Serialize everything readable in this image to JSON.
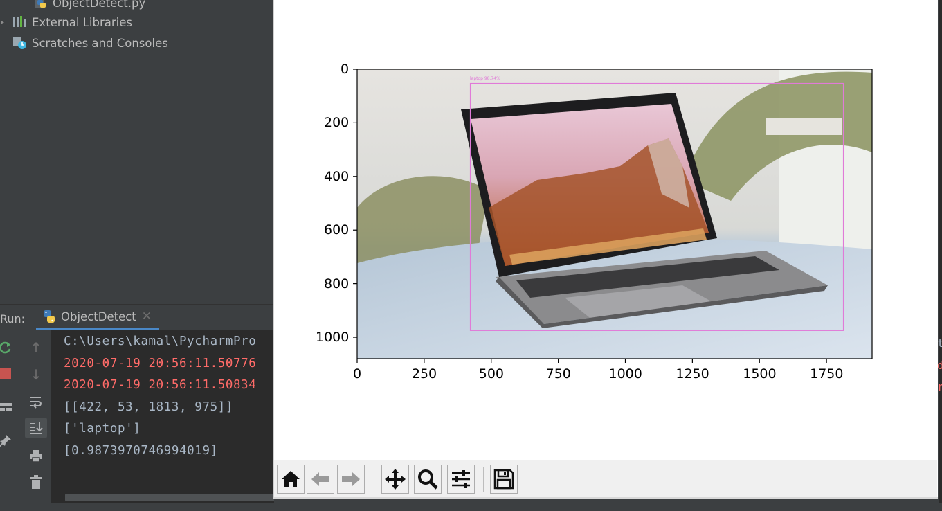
{
  "project_tree": {
    "items": [
      {
        "label": "ObjectDetect.py",
        "icon": "python-file-icon"
      },
      {
        "label": "External Libraries",
        "icon": "library-icon"
      },
      {
        "label": "Scratches and Consoles",
        "icon": "scratches-icon"
      }
    ]
  },
  "run_panel": {
    "label": "Run:",
    "tab_label": "ObjectDetect",
    "console_lines": [
      {
        "text": "C:\\Users\\kamal\\PycharmPro",
        "type": "normal"
      },
      {
        "text": "2020-07-19 20:56:11.50776",
        "type": "error"
      },
      {
        "text": "2020-07-19 20:56:11.50834",
        "type": "error"
      },
      {
        "text": "[[422, 53, 1813, 975]]",
        "type": "normal"
      },
      {
        "text": "['laptop']",
        "type": "normal"
      },
      {
        "text": "[0.9873970746994019]",
        "type": "normal"
      }
    ]
  },
  "right_strip_chars": [
    "t",
    "d",
    "r"
  ],
  "matplotlib": {
    "toolbar": [
      "home-icon",
      "back-icon",
      "forward-icon",
      "pan-icon",
      "zoom-icon",
      "configure-subplots-icon",
      "save-icon"
    ],
    "image": {
      "detection_label": "laptop 98.74%",
      "box_color": "#e07ad8"
    }
  },
  "chart_data": {
    "type": "image",
    "title": "",
    "xlabel": "",
    "ylabel": "",
    "x_ticks": [
      "0",
      "250",
      "500",
      "750",
      "1000",
      "1250",
      "1500",
      "1750"
    ],
    "y_ticks": [
      "0",
      "200",
      "400",
      "600",
      "800",
      "1000"
    ],
    "xlim": [
      0,
      1920
    ],
    "ylim": [
      1080,
      0
    ],
    "bounding_boxes": [
      {
        "label": "laptop",
        "score": 0.9873970746994019,
        "xmin": 422,
        "ymin": 53,
        "xmax": 1813,
        "ymax": 975
      }
    ]
  }
}
